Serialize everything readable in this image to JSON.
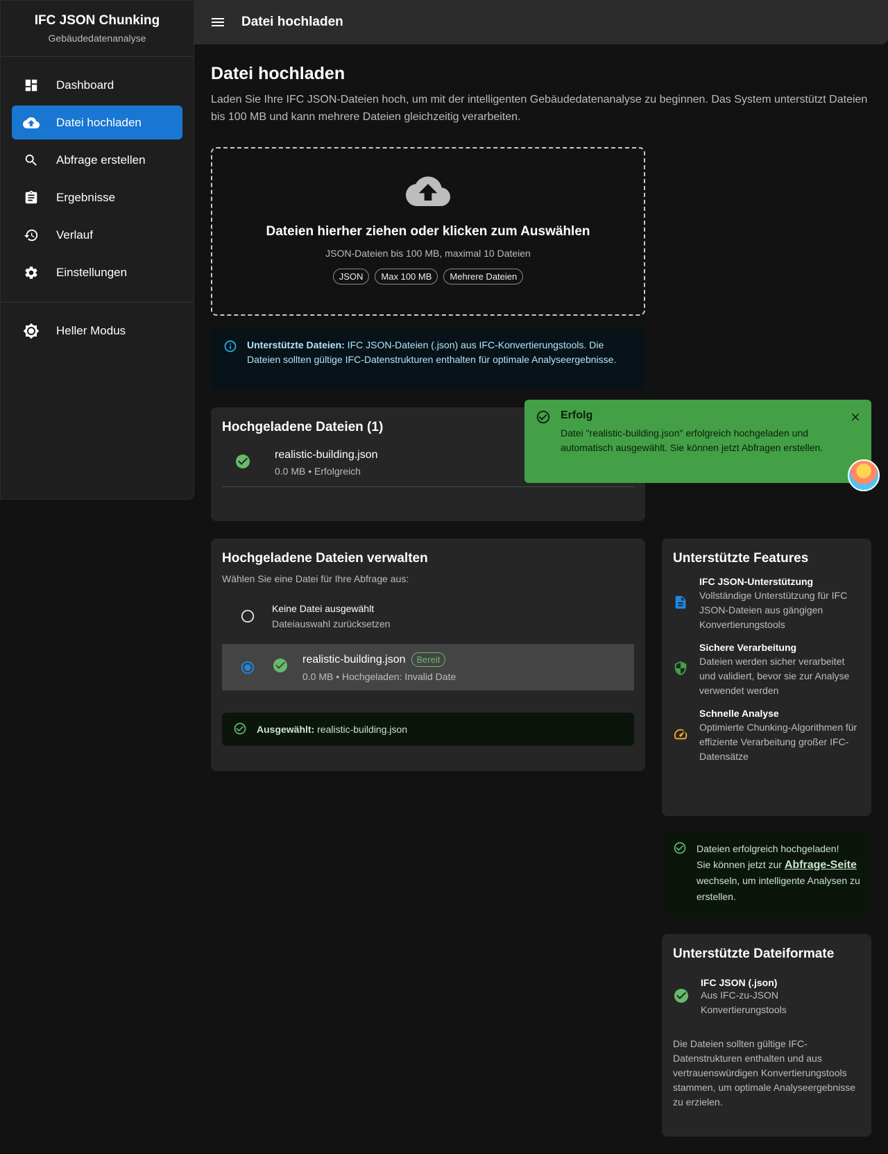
{
  "brand": {
    "title": "IFC JSON Chunking",
    "subtitle": "Gebäudedatenanalyse"
  },
  "nav": {
    "items": [
      {
        "label": "Dashboard",
        "icon": "dashboard-icon"
      },
      {
        "label": "Datei hochladen",
        "icon": "cloud-upload-icon",
        "active": true
      },
      {
        "label": "Abfrage erstellen",
        "icon": "search-icon"
      },
      {
        "label": "Ergebnisse",
        "icon": "clipboard-icon"
      },
      {
        "label": "Verlauf",
        "icon": "history-icon"
      },
      {
        "label": "Einstellungen",
        "icon": "gear-icon"
      }
    ],
    "theme_toggle": "Heller Modus"
  },
  "topbar": {
    "title": "Datei hochladen"
  },
  "page": {
    "title": "Datei hochladen",
    "intro": "Laden Sie Ihre IFC JSON-Dateien hoch, um mit der intelligenten Gebäudedatenanalyse zu beginnen. Das System unterstützt Dateien bis 100 MB und kann mehrere Dateien gleichzeitig verarbeiten."
  },
  "dropzone": {
    "title": "Dateien hierher ziehen oder klicken zum Auswählen",
    "subtitle": "JSON-Dateien bis 100 MB, maximal 10 Dateien",
    "chips": [
      "JSON",
      "Max 100 MB",
      "Mehrere Dateien"
    ]
  },
  "info": {
    "label": "Unterstützte Dateien:",
    "text": " IFC JSON-Dateien (.json) aus IFC-Konvertierungstools. Die Dateien sollten gültige IFC-Datenstrukturen enthalten für optimale Analyseergebnisse."
  },
  "uploaded": {
    "title": "Hochgeladene Dateien (1)",
    "files": [
      {
        "name": "realistic-building.json",
        "meta": "0.0 MB • Erfolgreich"
      }
    ]
  },
  "manage": {
    "title": "Hochgeladene Dateien verwalten",
    "subtitle": "Wählen Sie eine Datei für Ihre Abfrage aus:",
    "none_option": {
      "title": "Keine Datei ausgewählt",
      "sub": "Dateiauswahl zurücksetzen"
    },
    "file_option": {
      "name": "realistic-building.json",
      "badge": "Bereit",
      "meta": "0.0 MB • Hochgeladen: Invalid Date"
    },
    "selected_label": "Ausgewählt:",
    "selected_value": " realistic-building.json"
  },
  "features": {
    "title": "Unterstützte Features",
    "items": [
      {
        "title": "IFC JSON-Unterstützung",
        "desc": "Vollständige Unterstützung für IFC JSON-Dateien aus gängigen Konvertierungstools",
        "icon": "document-icon",
        "color": "#1e88e5"
      },
      {
        "title": "Sichere Verarbeitung",
        "desc": "Dateien werden sicher verarbeitet und validiert, bevor sie zur Analyse verwendet werden",
        "icon": "shield-icon",
        "color": "#43a047"
      },
      {
        "title": "Schnelle Analyse",
        "desc": "Optimierte Chunking-Algorithmen für effiziente Verarbeitung großer IFC-Datensätze",
        "icon": "speedometer-icon",
        "color": "#ffa726"
      }
    ]
  },
  "success_box": {
    "title": "Dateien erfolgreich hochgeladen!",
    "pre": "Sie können jetzt zur ",
    "link": "Abfrage-Seite",
    "post": " wechseln, um intelligente Analysen zu erstellen."
  },
  "formats": {
    "title": "Unterstützte Dateiformate",
    "item_title": "IFC JSON (.json)",
    "item_desc": "Aus IFC-zu-JSON Konvertierungstools",
    "note": "Die Dateien sollten gültige IFC-Datenstrukturen enthalten und aus vertrauenswürdigen Konvertierungstools stammen, um optimale Analyseergebnisse zu erzielen."
  },
  "toast": {
    "title": "Erfolg",
    "message": "Datei \"realistic-building.json\" erfolgreich hochgeladen und automatisch ausgewählt. Sie können jetzt Abfragen erstellen."
  },
  "colors": {
    "accent": "#1976d2",
    "success": "#43a047",
    "success_icon": "#66bb6a",
    "background": "#121212",
    "card": "#262626"
  }
}
